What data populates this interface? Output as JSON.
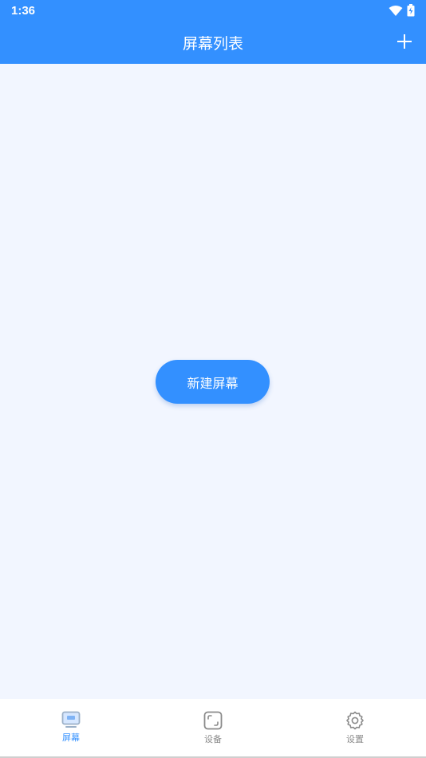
{
  "status_bar": {
    "time": "1:36",
    "icons": [
      "wifi-icon",
      "battery-icon"
    ]
  },
  "app_bar": {
    "title": "屏幕列表",
    "action_icon": "plus-icon",
    "color": "#3390ff"
  },
  "main": {
    "create_button_label": "新建屏幕"
  },
  "tab_bar": {
    "tabs": [
      {
        "label": "屏幕",
        "icon": "monitor-icon",
        "active": true
      },
      {
        "label": "设备",
        "icon": "device-frame-icon",
        "active": false
      },
      {
        "label": "设置",
        "icon": "gear-icon",
        "active": false
      }
    ],
    "active_color": "#3390ff",
    "inactive_color": "#8a8a8a"
  }
}
